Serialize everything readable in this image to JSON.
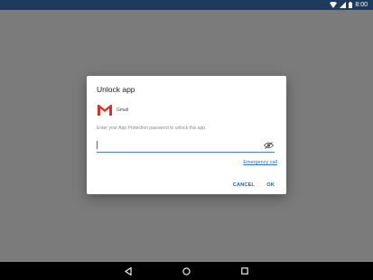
{
  "status_bar": {
    "time": "8:00",
    "icons": [
      "wifi-icon",
      "cellular-icon",
      "battery-icon"
    ]
  },
  "dialog": {
    "title": "Unlock app",
    "app": {
      "name": "Gmail",
      "icon": "gmail-icon"
    },
    "instruction": "Enter your App Protection password to unlock this app.",
    "password_value": "",
    "toggle_icon": "eye-off-icon",
    "emergency_link": "Emergency call",
    "cancel_label": "CANCEL",
    "ok_label": "OK"
  },
  "nav_bar": {
    "buttons": [
      "back-icon",
      "home-icon",
      "recents-icon"
    ]
  },
  "colors": {
    "status_bar": "#1e3a5c",
    "scrim": "#7b7b7b",
    "accent": "#1a5fa8",
    "gmail_red": "#d93025"
  }
}
